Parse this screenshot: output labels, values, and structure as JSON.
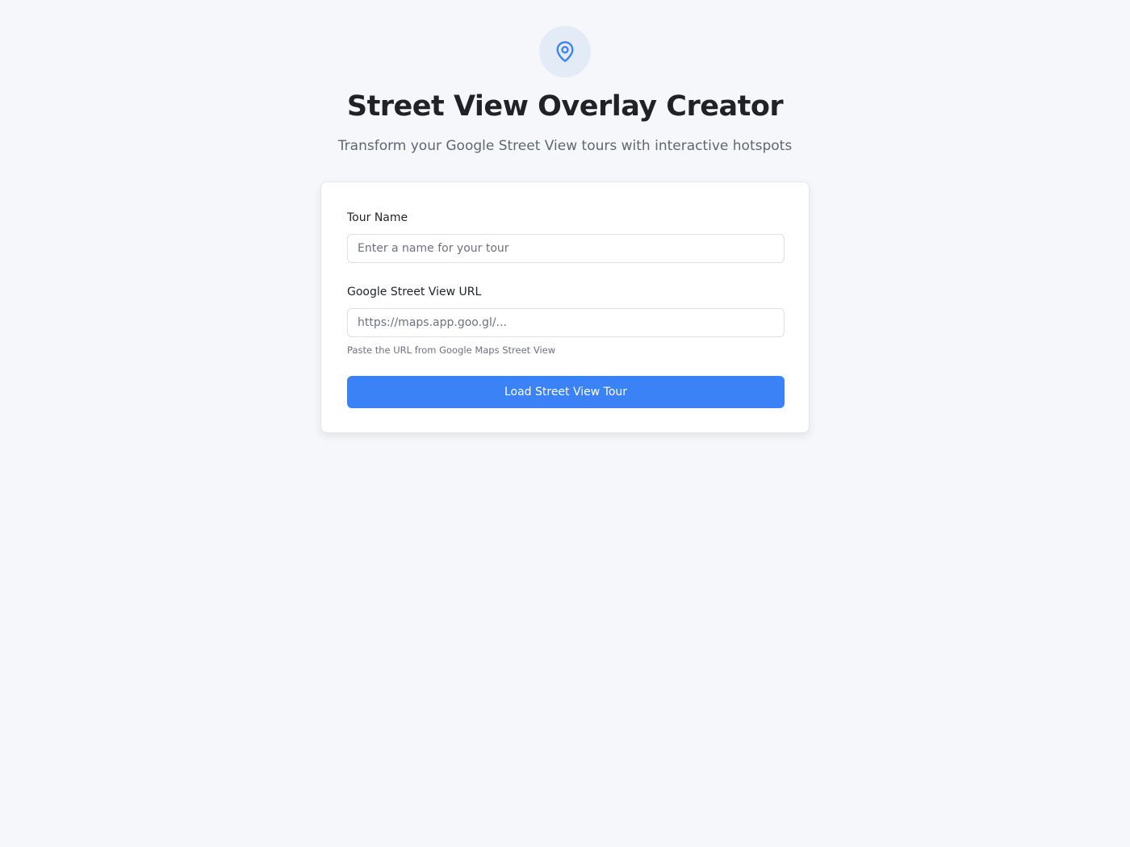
{
  "header": {
    "icon": "map-pin-icon",
    "title": "Street View Overlay Creator",
    "subtitle": "Transform your Google Street View tours with interactive hotspots"
  },
  "form": {
    "tour_name": {
      "label": "Tour Name",
      "value": "",
      "placeholder": "Enter a name for your tour"
    },
    "url": {
      "label": "Google Street View URL",
      "value": "",
      "placeholder": "https://maps.app.goo.gl/...",
      "help": "Paste the URL from Google Maps Street View"
    },
    "submit_label": "Load Street View Tour"
  },
  "colors": {
    "accent": "#3b82f6",
    "icon_bg": "#e3ebf7",
    "page_bg": "#f5f7fa"
  }
}
